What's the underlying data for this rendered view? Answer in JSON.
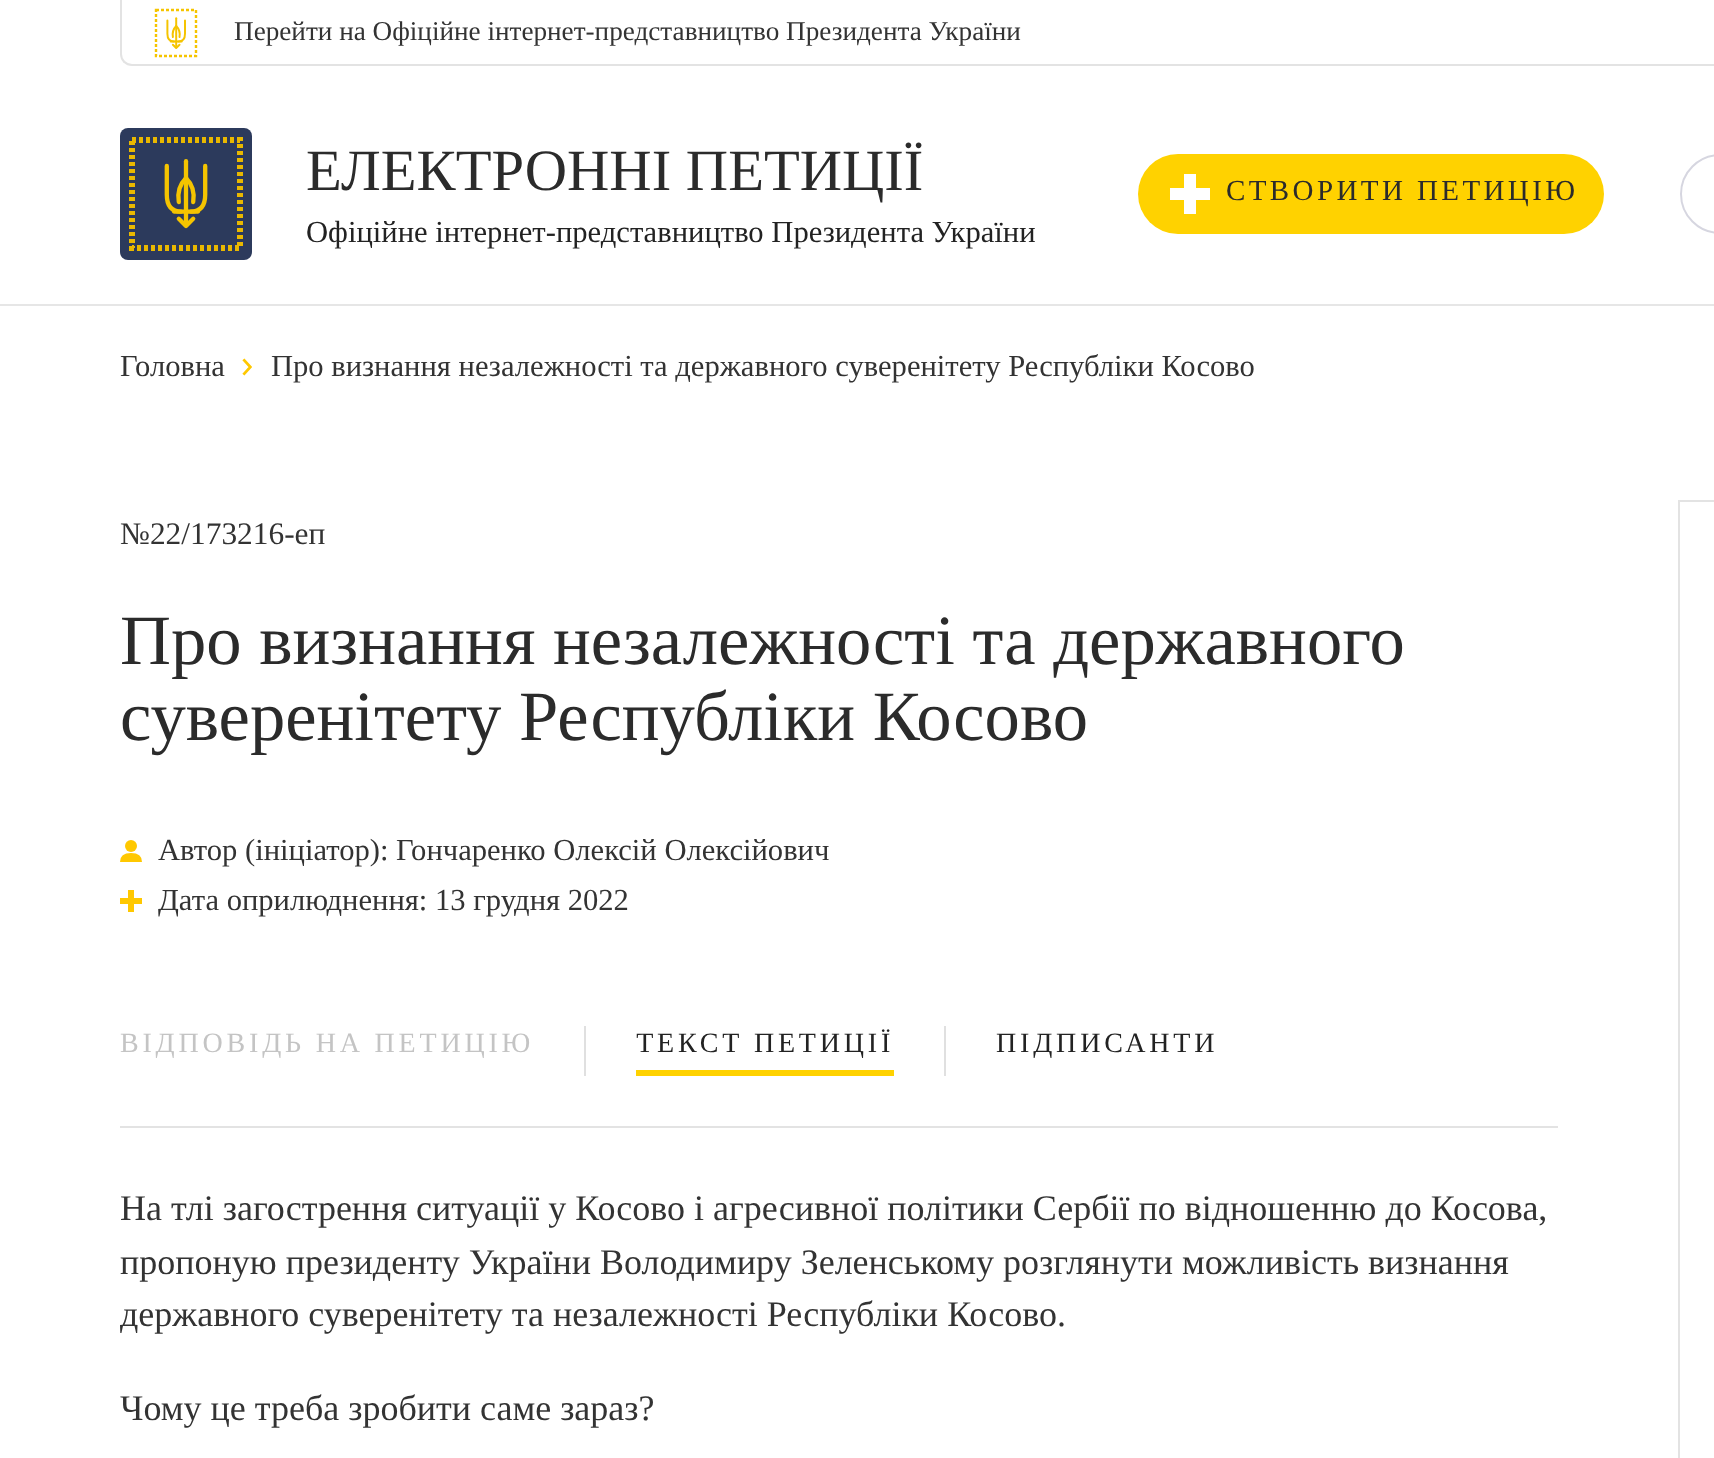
{
  "top_bar": {
    "link": "Перейти на Офіційне інтернет-представництво Президента України"
  },
  "header": {
    "title": "ЕЛЕКТРОННІ ПЕТИЦІЇ",
    "subtitle": "Офіційне інтернет-представництво Президента України",
    "create_button": "СТВОРИТИ ПЕТИЦІЮ"
  },
  "breadcrumbs": [
    {
      "label": "Головна"
    },
    {
      "label": "Про визнання незалежності та державного суверенітету Республіки Косово"
    }
  ],
  "petition": {
    "number": "№22/173216-еп",
    "title": "Про визнання незалежності та державного суверенітету Республіки Косово",
    "meta": [
      {
        "kind": "author",
        "text": "Автор (ініціатор): Гончаренко Олексій Олексійович"
      },
      {
        "kind": "date",
        "text": "Дата оприлюднення: 13 грудня 2022"
      }
    ]
  },
  "tabs": [
    {
      "label": "ВІДПОВІДЬ НА ПЕТИЦІЮ",
      "selected": false,
      "disabled": true
    },
    {
      "label": "ТЕКСТ ПЕТИЦІЇ",
      "selected": true,
      "disabled": false
    },
    {
      "label": "ПІДПИСАНТИ",
      "selected": false,
      "disabled": false
    }
  ],
  "body": [
    "На тлі загострення ситуації у Косово і агресивної політики Сербії по відношенню до Косова, пропоную президенту України Володимиру Зеленському розглянути можливість визнання державного суверенітету та незалежності Республіки Косово.",
    "Чому це треба зробити саме зараз?"
  ]
}
